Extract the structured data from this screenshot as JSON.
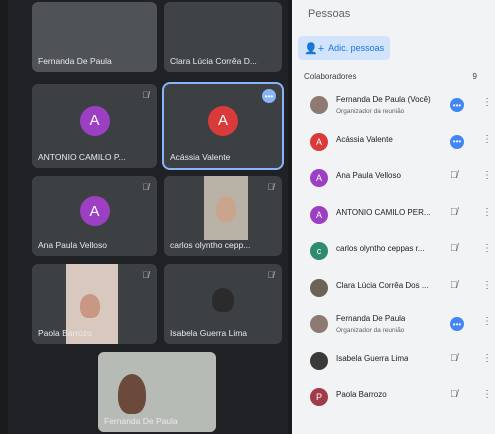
{
  "panel": {
    "title": "Pessoas",
    "add_label": "Adic. pessoas",
    "section_label": "Colaboradores",
    "section_count": "9",
    "people": [
      {
        "name": "Fernanda De Paula (Você)",
        "sub": "Organizador da reunião",
        "initial": "",
        "color": "#8d7a70",
        "status": "more"
      },
      {
        "name": "Acássia Valente",
        "sub": "",
        "initial": "A",
        "color": "#d93a3a",
        "status": "more"
      },
      {
        "name": "Ana Paula Velloso",
        "sub": "",
        "initial": "A",
        "color": "#9c3fc2",
        "status": "mic-off"
      },
      {
        "name": "ANTONIO CAMILO PER...",
        "sub": "",
        "initial": "A",
        "color": "#9c3fc2",
        "status": "mic-off"
      },
      {
        "name": "carlos olyntho ceppas r...",
        "sub": "",
        "initial": "c",
        "color": "#2e8b6e",
        "status": "mic-off"
      },
      {
        "name": "Clara Lúcia Corrêa Dos ...",
        "sub": "",
        "initial": "",
        "color": "#6d6256",
        "status": "mic-off"
      },
      {
        "name": "Fernanda De Paula",
        "sub": "Organizador da reunião",
        "initial": "",
        "color": "#8d7a70",
        "status": "more"
      },
      {
        "name": "Isabela Guerra Lima",
        "sub": "",
        "initial": "",
        "color": "#3a3a3a",
        "status": "mic-off"
      },
      {
        "name": "Paola Barrozo",
        "sub": "",
        "initial": "P",
        "color": "#a13b4a",
        "status": "mic-off"
      }
    ]
  },
  "tiles": {
    "fernanda_top": "Fernanda De Paula",
    "clara": "Clara Lúcia Corrêa D...",
    "antonio": "ANTONIO CAMILO P...",
    "antonio_initial": "A",
    "acassia": "Acássia Valente",
    "acassia_initial": "A",
    "ana": "Ana Paula Velloso",
    "ana_initial": "A",
    "carlos": "carlos olyntho cepp...",
    "paola": "Paola Barrozo",
    "isabela": "Isabela Guerra Lima",
    "fernanda_bottom": "Fernanda De Paula"
  },
  "icons": {
    "mic_off": "🎙",
    "more": "•••",
    "kebab": "⋮",
    "add_person": "+"
  }
}
